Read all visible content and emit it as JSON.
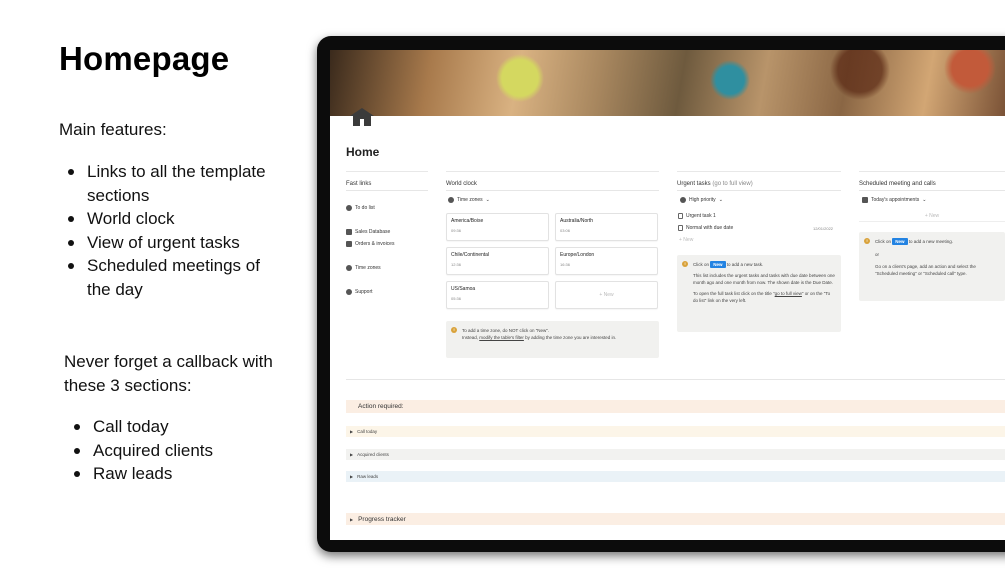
{
  "slide": {
    "title": "Homepage",
    "subtitle": "Main features:",
    "features": [
      "Links to all the template sections",
      "World clock",
      "View of urgent tasks",
      "Scheduled meetings of the day"
    ],
    "callback_intro": "Never forget a callback with these 3 sections:",
    "sections": [
      "Call today",
      "Acquired clients",
      "Raw leads"
    ]
  },
  "app": {
    "page_title": "Home",
    "fast_links": {
      "header": "Fast links",
      "items": [
        {
          "label": "To do list",
          "icon": "checklist-icon"
        },
        {
          "label": "Sales Database",
          "icon": "database-icon"
        },
        {
          "label": "Orders & invoices",
          "icon": "invoice-icon"
        },
        {
          "label": "Time zones",
          "icon": "globe-icon"
        },
        {
          "label": "Support",
          "icon": "info-icon"
        }
      ]
    },
    "world_clock": {
      "header": "World clock",
      "view": "Time zones",
      "cards": [
        {
          "name": "America/Boise",
          "time": "09:36"
        },
        {
          "name": "Australia/North",
          "time": "03:06"
        },
        {
          "name": "Chile/Continental",
          "time": "12:36"
        },
        {
          "name": "Europe/London",
          "time": "16:36"
        },
        {
          "name": "US/Samoa",
          "time": "05:36"
        }
      ],
      "new_label": "+ New",
      "callout_line1": "To add a time zone, do NOT click on \"New\".",
      "callout_line2_pre": "Instead, ",
      "callout_line2_link": "modify the table's filter",
      "callout_line2_post": " by adding the time zone you are interested in."
    },
    "urgent_tasks": {
      "header": "Urgent tasks",
      "header_link": "(go to full view)",
      "view": "High priority",
      "tasks": [
        {
          "label": "Urgent task 1",
          "date": ""
        },
        {
          "label": "Normal with due date",
          "date": "12/01/2022"
        }
      ],
      "new_label": "+ New",
      "callout_pre": "Click on ",
      "callout_badge": "New",
      "callout_post": " to add a new task.",
      "callout_p1": "This list includes the urgent tasks and tasks with due date between one month ago and one month from now. The shown date is the Due Date.",
      "callout_p2_pre": "To open the full task list click on the title \"",
      "callout_p2_link": "go to full view",
      "callout_p2_post": "\" or on the \"To do list\" link on the very left."
    },
    "meetings": {
      "header": "Scheduled meeting and calls",
      "view": "Today's appointments",
      "new_label": "+ New",
      "callout_pre": "Click on ",
      "callout_badge": "New",
      "callout_post": " to add a new meeting.",
      "or_text": "or",
      "callout_p2": "Go on a client's page, add an action and select the \"Scheduled meeting\" or \"Scheduled call\" type."
    },
    "action_required": "Action required:",
    "toggles": [
      "Call today",
      "Acquired clients",
      "Raw leads"
    ],
    "progress_tracker": "Progress tracker"
  }
}
